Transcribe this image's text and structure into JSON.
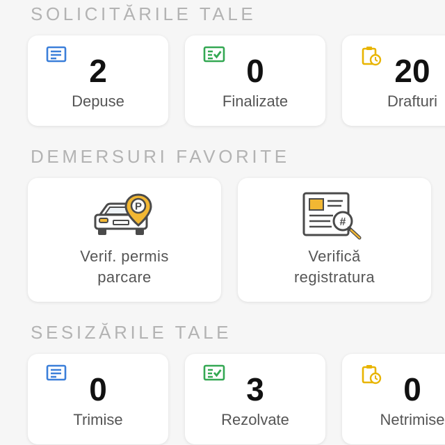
{
  "sections": {
    "requests_title": "SOLICITĂRILE TALE",
    "favorites_title": "DEMERSURI FAVORITE",
    "reports_title": "SESIZĂRILE TALE"
  },
  "requests": {
    "submitted": {
      "value": "2",
      "label": "Depuse",
      "icon": "document-icon",
      "color": "#3b7fd9"
    },
    "finalized": {
      "value": "0",
      "label": "Finalizate",
      "icon": "checklist-icon",
      "color": "#34a853"
    },
    "drafts": {
      "value": "20",
      "label": "Drafturi",
      "icon": "clipboard-clock-icon",
      "color": "#e8b400"
    }
  },
  "favorites": {
    "parking_permit": {
      "line1": "Verif. permis",
      "line2": "parcare",
      "icon": "car-parking-icon"
    },
    "registry": {
      "line1": "Verifică",
      "line2": "registratura",
      "icon": "registry-search-icon"
    }
  },
  "reports": {
    "sent": {
      "value": "0",
      "label": "Trimise",
      "icon": "document-icon",
      "color": "#3b7fd9"
    },
    "resolved": {
      "value": "3",
      "label": "Rezolvate",
      "icon": "checklist-icon",
      "color": "#34a853"
    },
    "unsent": {
      "value": "0",
      "label": "Netrimise",
      "icon": "clipboard-clock-icon",
      "color": "#e8b400"
    }
  },
  "colors": {
    "accent_yellow": "#f2b733",
    "title_gray": "#b3b3b3"
  }
}
